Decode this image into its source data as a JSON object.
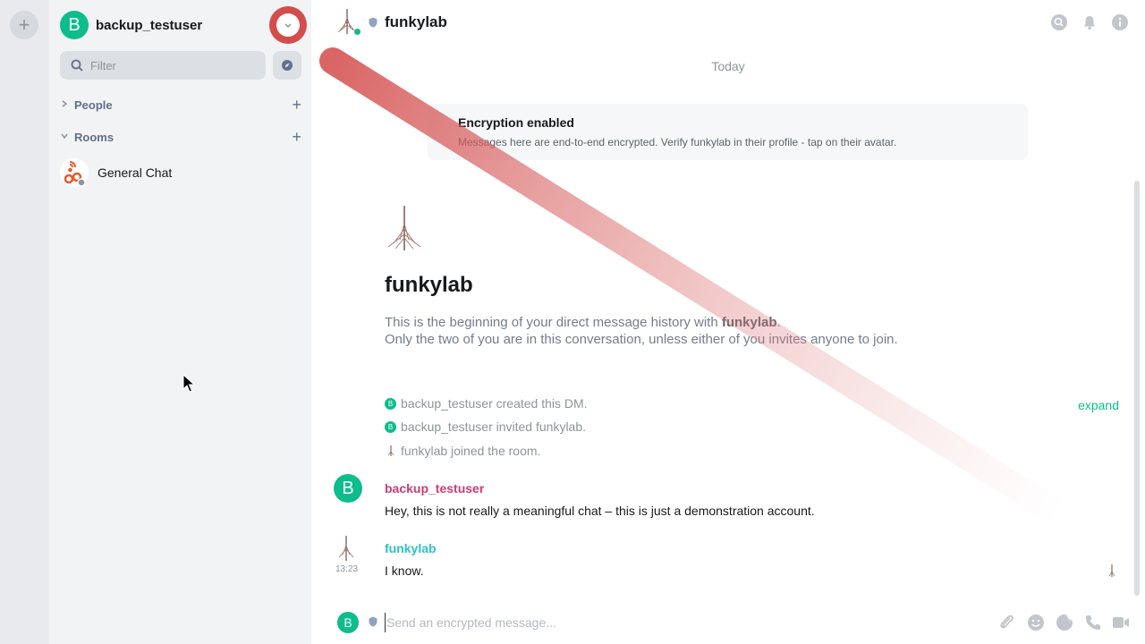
{
  "space_strip": {
    "add_icon": "plus-icon"
  },
  "user_menu": {
    "initial": "B",
    "name": "backup_testuser",
    "dropdown_icon": "chevron-down-icon"
  },
  "filter": {
    "placeholder": "Filter",
    "icon": "search-icon",
    "explore_icon": "compass-icon"
  },
  "sections": {
    "people": {
      "label": "People",
      "expanded": false
    },
    "rooms": {
      "label": "Rooms",
      "expanded": true
    }
  },
  "rooms": [
    {
      "name": "General Chat",
      "icon": "matrix-room-icon"
    }
  ],
  "header": {
    "room_name": "funkylab",
    "status": "online",
    "icons": [
      "search-icon",
      "bell-icon",
      "info-icon"
    ]
  },
  "timeline": {
    "date_separator": "Today",
    "encryption": {
      "title": "Encryption enabled",
      "description": "Messages here are end-to-end encrypted. Verify funkylab in their profile - tap on their avatar."
    },
    "intro": {
      "name": "funkylab",
      "line1_prefix": "This is the beginning of your direct message history with ",
      "line1_name": "funkylab",
      "line1_suffix": ".",
      "line2": "Only the two of you are in this conversation, unless either of you invites anyone to join."
    },
    "events": [
      {
        "initial": "B",
        "text": "backup_testuser created this DM."
      },
      {
        "initial": "B",
        "text": "backup_testuser invited funkylab."
      },
      {
        "initial": "",
        "text": "funkylab joined the room."
      }
    ],
    "expand_label": "expand",
    "messages": [
      {
        "sender": "backup_testuser",
        "sender_color": "#ce3b76",
        "initial": "B",
        "body": "Hey, this is not really a meaningful chat – this is just a demonstration account.",
        "time": ""
      },
      {
        "sender": "funkylab",
        "sender_color": "#2dc2c5",
        "initial": "",
        "body": "I know.",
        "time": "13:23"
      }
    ]
  },
  "composer": {
    "initial": "B",
    "placeholder": "Send an encrypted message...",
    "icons": [
      "paperclip-icon",
      "emoji-icon",
      "sticker-icon",
      "phone-icon",
      "video-icon"
    ]
  },
  "colors": {
    "accent": "#0dbd8b",
    "highlight_red": "#d44c4c"
  }
}
